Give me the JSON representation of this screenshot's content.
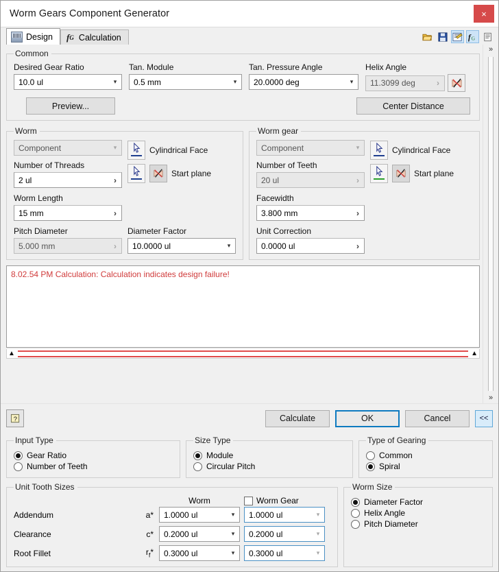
{
  "window": {
    "title": "Worm Gears Component Generator",
    "close_label": "×",
    "accent_blue": "#0d7ac0",
    "close_red": "#d64a4a",
    "error_red": "#d03b3b"
  },
  "tabs": [
    {
      "label": "Design",
      "icon": "gear-hatch-icon",
      "active": true
    },
    {
      "label": "Calculation",
      "icon": "fx-icon",
      "active": false
    }
  ],
  "toolbar": [
    {
      "name": "open-file-icon",
      "glyph": "📂",
      "selected": false
    },
    {
      "name": "save-file-icon",
      "glyph": "💾",
      "selected": false
    },
    {
      "name": "results-report-icon",
      "glyph": "🗒",
      "selected": true
    },
    {
      "name": "fx-calculation-icon",
      "glyph": "ƒ",
      "selected": true
    },
    {
      "name": "notepad-icon",
      "glyph": "📝",
      "selected": false
    }
  ],
  "scroll": {
    "up_glyph": "»",
    "down_glyph": "»"
  },
  "common": {
    "legend": "Common",
    "gear_ratio": {
      "label": "Desired Gear Ratio",
      "value": "10.0 ul",
      "disabled": false
    },
    "tan_module": {
      "label": "Tan. Module",
      "value": "0.5 mm",
      "disabled": false
    },
    "pressure_angle": {
      "label": "Tan. Pressure Angle",
      "value": "20.0000 deg",
      "disabled": false
    },
    "helix_angle": {
      "label": "Helix Angle",
      "value": "11.3099 deg",
      "disabled": true
    },
    "helix_icon": "start-plane-icon",
    "preview_label": "Preview...",
    "center_distance_label": "Center Distance"
  },
  "worm": {
    "legend": "Worm",
    "component": {
      "value": "Component",
      "disabled": true
    },
    "cyl_face_label": "Cylindrical Face",
    "start_plane_label": "Start plane",
    "threads": {
      "label": "Number of Threads",
      "value": "2 ul",
      "disabled": false
    },
    "length": {
      "label": "Worm Length",
      "value": "15 mm",
      "disabled": false
    },
    "pitch_diameter": {
      "label": "Pitch Diameter",
      "value": "5.000 mm",
      "disabled": true
    },
    "diameter_factor": {
      "label": "Diameter Factor",
      "value": "10.0000 ul",
      "disabled": false
    },
    "bar_color": "#1f3f8f"
  },
  "worm_gear": {
    "legend": "Worm gear",
    "component": {
      "value": "Component",
      "disabled": true
    },
    "cyl_face_label": "Cylindrical Face",
    "start_plane_label": "Start plane",
    "teeth": {
      "label": "Number of Teeth",
      "value": "20 ul",
      "disabled": true
    },
    "facewidth": {
      "label": "Facewidth",
      "value": "3.800 mm",
      "disabled": false
    },
    "unit_correction": {
      "label": "Unit Correction",
      "value": "0.0000 ul",
      "disabled": false
    },
    "bar_color": "#2aa02a"
  },
  "messages": {
    "lines": [
      "8.02.54 PM Calculation: Calculation indicates design failure!"
    ]
  },
  "footer": {
    "help_label": "?",
    "calculate_label": "Calculate",
    "ok_label": "OK",
    "cancel_label": "Cancel",
    "collapse_label": "<<"
  },
  "input_type": {
    "legend": "Input Type",
    "options": [
      {
        "label": "Gear Ratio",
        "selected": true
      },
      {
        "label": "Number of Teeth",
        "selected": false
      }
    ]
  },
  "size_type": {
    "legend": "Size Type",
    "options": [
      {
        "label": "Module",
        "selected": true
      },
      {
        "label": "Circular Pitch",
        "selected": false
      }
    ]
  },
  "type_of_gearing": {
    "legend": "Type of Gearing",
    "options": [
      {
        "label": "Common",
        "selected": false
      },
      {
        "label": "Spiral",
        "selected": true
      }
    ]
  },
  "unit_tooth_sizes": {
    "legend": "Unit Tooth Sizes",
    "col_worm": "Worm",
    "col_worm_gear": "Worm Gear",
    "worm_gear_checked": false,
    "rows": [
      {
        "name": "Addendum",
        "symbol": "a*",
        "worm": "1.0000 ul",
        "worm_gear": "1.0000 ul"
      },
      {
        "name": "Clearance",
        "symbol": "c*",
        "worm": "0.2000 ul",
        "worm_gear": "0.2000 ul"
      },
      {
        "name": "Root Fillet",
        "symbol": "rf*",
        "worm": "0.3000 ul",
        "worm_gear": "0.3000 ul"
      }
    ]
  },
  "worm_size": {
    "legend": "Worm Size",
    "options": [
      {
        "label": "Diameter Factor",
        "selected": true
      },
      {
        "label": "Helix Angle",
        "selected": false
      },
      {
        "label": "Pitch Diameter",
        "selected": false
      }
    ]
  }
}
